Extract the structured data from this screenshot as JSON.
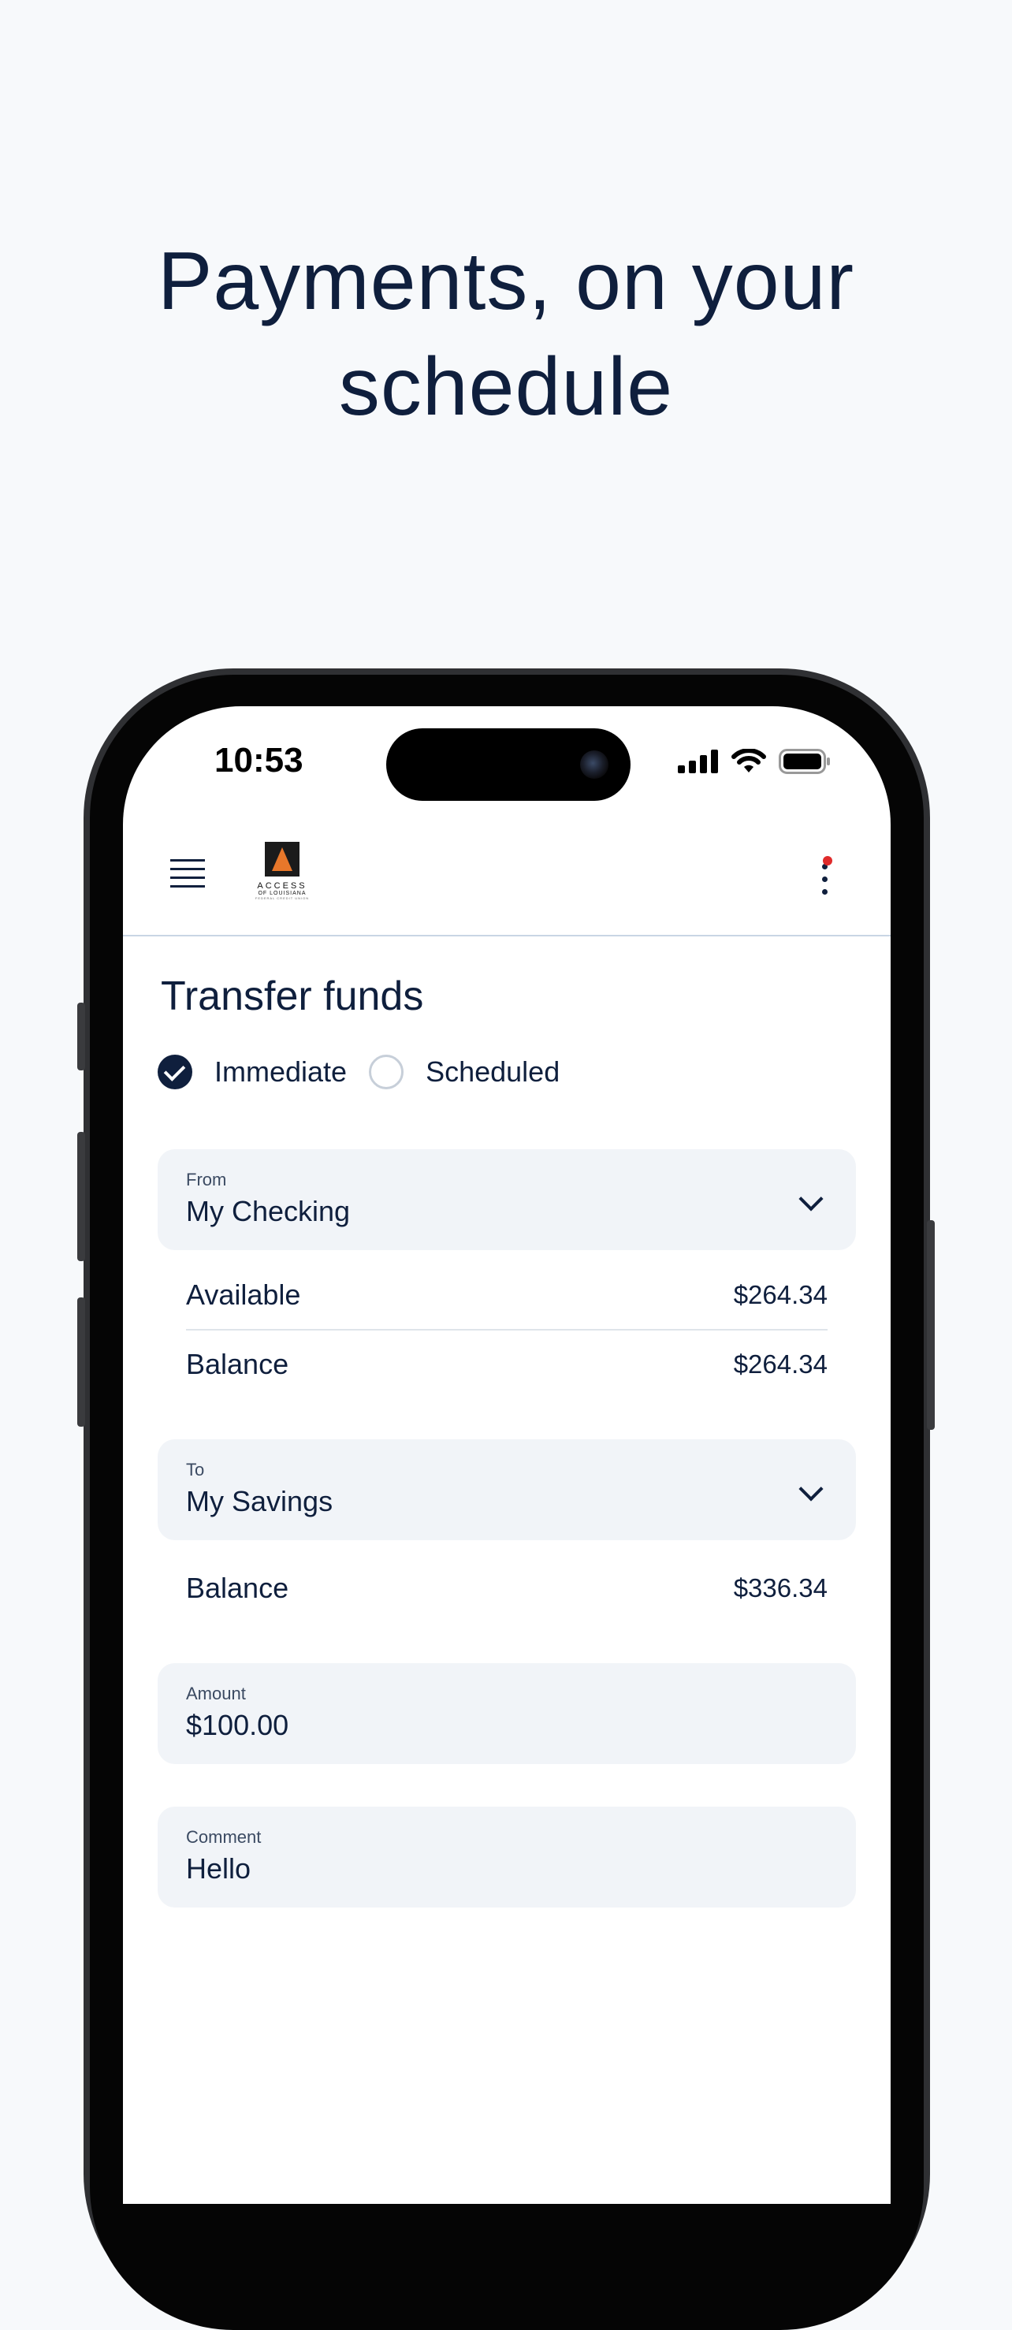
{
  "headline": {
    "line1": "Payments, on your",
    "line2": "schedule"
  },
  "status_bar": {
    "time": "10:53"
  },
  "app_bar": {
    "logo": {
      "name": "ACCESS",
      "sub": "OF LOUISIANA",
      "tiny": "FEDERAL CREDIT UNION"
    }
  },
  "page": {
    "title": "Transfer funds"
  },
  "transfer_type": {
    "options": [
      {
        "label": "Immediate",
        "selected": true
      },
      {
        "label": "Scheduled",
        "selected": false
      }
    ]
  },
  "from": {
    "label": "From",
    "value": "My Checking",
    "rows": [
      {
        "label": "Available",
        "value": "$264.34"
      },
      {
        "label": "Balance",
        "value": "$264.34"
      }
    ]
  },
  "to": {
    "label": "To",
    "value": "My Savings",
    "rows": [
      {
        "label": "Balance",
        "value": "$336.34"
      }
    ]
  },
  "amount": {
    "label": "Amount",
    "value": "$100.00"
  },
  "comment": {
    "label": "Comment",
    "value": "Hello"
  },
  "colors": {
    "primary": "#0f1f3d",
    "field_bg": "#f1f4f8",
    "page_bg": "#f7f9fb",
    "notification": "#e02b2b"
  }
}
